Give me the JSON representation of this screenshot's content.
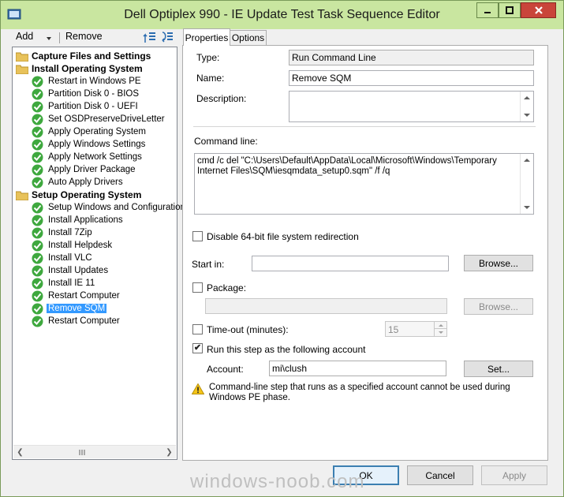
{
  "window": {
    "title": "Dell Optiplex 990 - IE Update Test Task Sequence Editor",
    "titlebar_color": "#c9e6a0"
  },
  "left_toolbar": {
    "add_label": "Add",
    "remove_label": "Remove"
  },
  "tree": {
    "groups": [
      {
        "label": "Capture Files and Settings",
        "steps": []
      },
      {
        "label": "Install Operating System",
        "steps": [
          "Restart in Windows PE",
          "Partition Disk 0 - BIOS",
          "Partition Disk 0 - UEFI",
          "Set OSDPreserveDriveLetter",
          "Apply Operating System",
          "Apply Windows Settings",
          "Apply Network Settings",
          "Apply Driver Package",
          "Auto Apply Drivers"
        ]
      },
      {
        "label": "Setup Operating System",
        "steps": [
          "Setup Windows and Configuration",
          "Install Applications",
          "Install 7Zip",
          "Install Helpdesk",
          "Install VLC",
          "Install Updates",
          "Install IE 11",
          "Restart Computer",
          "Remove SQM",
          "Restart Computer"
        ]
      }
    ],
    "selected": "Remove SQM"
  },
  "tabs": {
    "properties": "Properties",
    "options": "Options"
  },
  "properties": {
    "type_label": "Type:",
    "type_value": "Run Command Line",
    "name_label": "Name:",
    "name_value": "Remove SQM",
    "description_label": "Description:",
    "description_value": "",
    "command_line_label": "Command line:",
    "command_line_line1": "cmd /c del \"C:\\Users\\Default\\AppData\\Local\\Microsoft\\Windows\\Temporary",
    "command_line_line2": "Internet Files\\SQM\\iesqmdata_setup0.sqm\" /f /q",
    "disable_redirection_label": "Disable 64-bit file system redirection",
    "disable_redirection_checked": false,
    "start_in_label": "Start in:",
    "start_in_value": "",
    "browse_label": "Browse...",
    "package_label": "Package:",
    "package_checked": false,
    "package_value": "",
    "package_browse_label": "Browse...",
    "timeout_label": "Time-out (minutes):",
    "timeout_checked": false,
    "timeout_value": "15",
    "run_as_label": "Run this step as the following account",
    "run_as_checked": true,
    "account_label": "Account:",
    "account_value": "mi\\clush",
    "set_label": "Set...",
    "warning_text": "Command-line step that runs as a specified account cannot be used during Windows PE phase."
  },
  "buttons": {
    "ok": "OK",
    "cancel": "Cancel",
    "apply": "Apply"
  },
  "watermark": "windows-noob.com"
}
